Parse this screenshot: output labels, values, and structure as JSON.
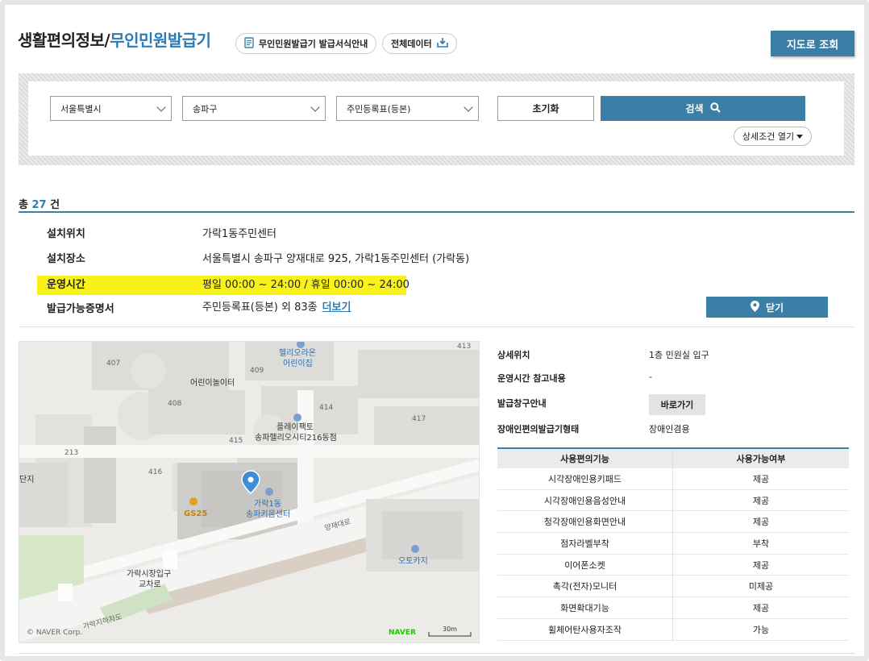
{
  "header": {
    "title_main": "생활편의정보/",
    "title_accent": "무인민원발급기",
    "guide_button": "무인민원발급기 발급서식안내",
    "download_button": "전체데이터",
    "map_button": "지도로 조회"
  },
  "search": {
    "city": "서울특별시",
    "district": "송파구",
    "document": "주민등록표(등본)",
    "reset_label": "초기화",
    "search_label": "검색",
    "detail_toggle": "상세조건 열기"
  },
  "result": {
    "prefix": "총",
    "count": "27",
    "suffix": "건"
  },
  "info": {
    "location_label": "설치위치",
    "location_value": "가락1동주민센터",
    "place_label": "설치장소",
    "place_value": "서울특별시 송파구 양재대로 925, 가락1동주민센터 (가락동)",
    "hours_label": "운영시간",
    "hours_value": "평일 00:00 ~ 24:00 / 휴일 00:00 ~ 24:00",
    "docs_label": "발급가능증명서",
    "docs_value": "주민등록표(등본) 외 83종",
    "more_link": "더보기",
    "close_button": "닫기"
  },
  "map": {
    "labels": {
      "b407": "407",
      "b409": "409",
      "b408": "408",
      "b413": "413",
      "b414": "414",
      "b415": "415",
      "b416": "416",
      "b417": "417",
      "b213": "213",
      "danji": "단지",
      "helio_1": "헬리오라온",
      "helio_2": "어린이집",
      "kids_land": "어린이놀이터",
      "play_1": "플레이팩토",
      "play_2": "송파헬리오시티216동점",
      "gs25": "GS25",
      "center_1": "가락1동",
      "center_2": "송파키움센터",
      "road": "양재대로",
      "otokaji": "오토카지",
      "market_1": "가락시장입구",
      "market_2": "교차로",
      "underpass": "가락지하차도",
      "copyright": "© NAVER Corp.",
      "naver": "NAVER",
      "scale": "30m"
    }
  },
  "details": {
    "sub_location_label": "상세위치",
    "sub_location_value": "1층 민원실 입구",
    "hours_note_label": "운영시간 참고내용",
    "hours_note_value": "-",
    "window_label": "발급창구안내",
    "window_button": "바로가기",
    "accessibility_label": "장애인편의발급기형태",
    "accessibility_value": "장애인겸용"
  },
  "features": {
    "col1": "사용편의기능",
    "col2": "사용가능여부",
    "rows": [
      {
        "name": "시각장애인용키패드",
        "status": "제공"
      },
      {
        "name": "시각장애인용음성안내",
        "status": "제공"
      },
      {
        "name": "청각장애인용화면안내",
        "status": "제공"
      },
      {
        "name": "점자라벨부착",
        "status": "부착"
      },
      {
        "name": "이어폰소켓",
        "status": "제공"
      },
      {
        "name": "촉각(전자)모니터",
        "status": "미제공"
      },
      {
        "name": "화면확대기능",
        "status": "제공"
      },
      {
        "name": "휠체어탄사용자조작",
        "status": "가능"
      }
    ]
  },
  "colors": {
    "accent": "#2c7bb6",
    "button": "#3b7ea6",
    "highlight": "#f8f21a"
  }
}
